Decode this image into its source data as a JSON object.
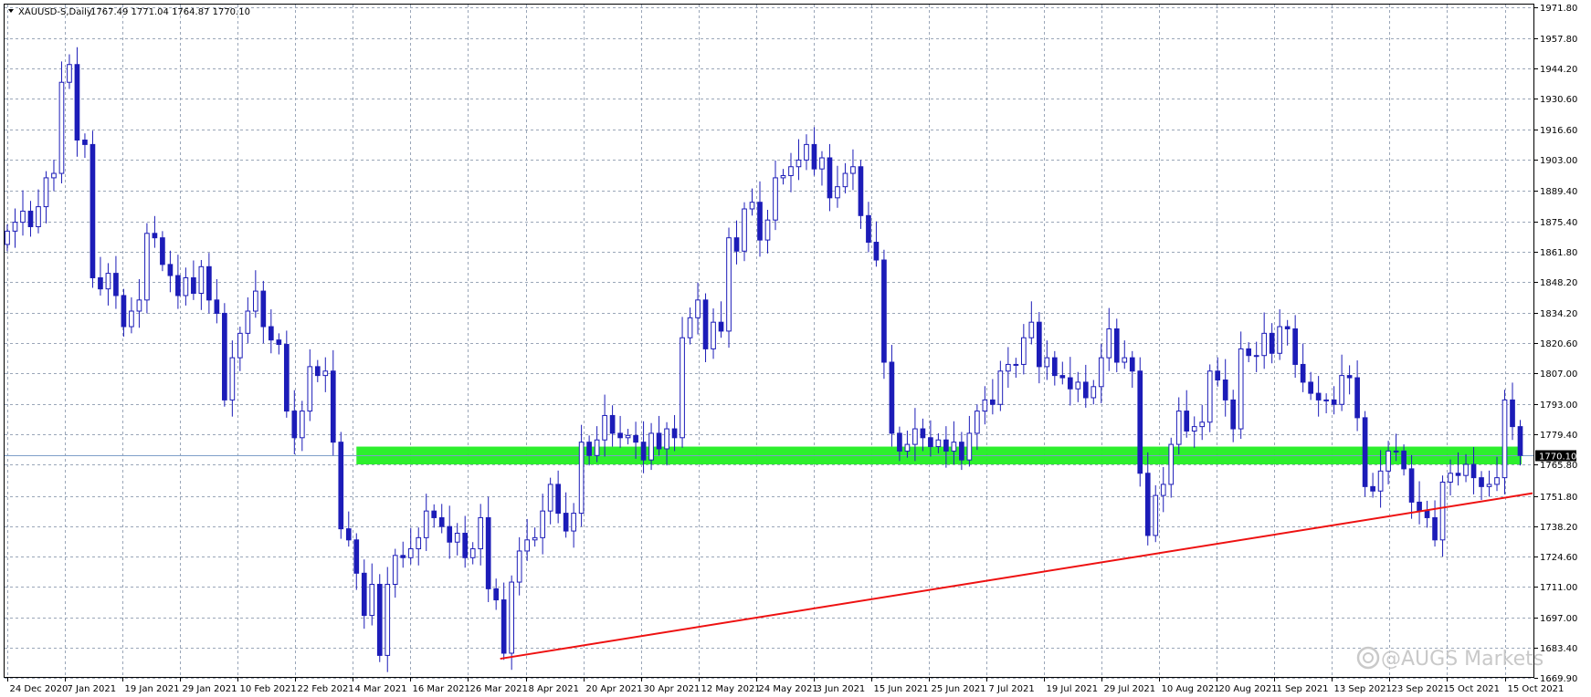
{
  "chart_data": {
    "type": "candlestick",
    "title": "XAUUSD-S,Daily  1767.49 1771.04 1764.87 1770.10",
    "symbol_period": "XAUUSD-S,Daily",
    "ohlc_header": "1767.49 1771.04 1764.87 1770.10",
    "ylim": [
      1669.9,
      1973.0
    ],
    "y_ticks": [
      "1971.80",
      "1957.80",
      "1944.20",
      "1930.60",
      "1916.60",
      "1903.00",
      "1889.40",
      "1875.40",
      "1861.80",
      "1848.20",
      "1834.20",
      "1820.60",
      "1807.00",
      "1793.00",
      "1779.40",
      "1765.80",
      "1751.80",
      "1738.20",
      "1724.60",
      "1711.00",
      "1697.00",
      "1683.40",
      "1669.90"
    ],
    "x_ticks": [
      "24 Dec 2020",
      "7 Jan 2021",
      "19 Jan 2021",
      "29 Jan 2021",
      "10 Feb 2021",
      "22 Feb 2021",
      "4 Mar 2021",
      "16 Mar 2021",
      "26 Mar 2021",
      "8 Apr 2021",
      "20 Apr 2021",
      "30 Apr 2021",
      "12 May 2021",
      "24 May 2021",
      "3 Jun 2021",
      "15 Jun 2021",
      "25 Jun 2021",
      "7 Jul 2021",
      "19 Jul 2021",
      "29 Jul 2021",
      "10 Aug 2021",
      "20 Aug 2021",
      "1 Sep 2021",
      "13 Sep 2021",
      "23 Sep 2021",
      "5 Oct 2021",
      "15 Oct 2021"
    ],
    "current_price": "1770.10",
    "support_zone": {
      "low": 1766.0,
      "high": 1774.0,
      "color": "#22ee22"
    },
    "trendline": {
      "from_date": "29 Mar 2021",
      "from_price": 1678.5,
      "to_date": "19 Oct 2021",
      "to_price": 1753.0,
      "color": "#ee1111"
    },
    "candle_color": "#1c1cb8",
    "grid": true,
    "watermark": "@AUGS Markets",
    "closes": [
      1871,
      1875,
      1880,
      1873,
      1882,
      1895,
      1897,
      1938,
      1946,
      1912,
      1910,
      1850,
      1845,
      1852,
      1842,
      1828,
      1835,
      1840,
      1870,
      1868,
      1856,
      1851,
      1842,
      1850,
      1843,
      1855,
      1840,
      1834,
      1795,
      1814,
      1825,
      1835,
      1844,
      1828,
      1822,
      1820,
      1790,
      1778,
      1790,
      1810,
      1806,
      1808,
      1776,
      1737,
      1732,
      1717,
      1698,
      1712,
      1680,
      1712,
      1725,
      1724,
      1728,
      1733,
      1745,
      1742,
      1738,
      1731,
      1735,
      1724,
      1728,
      1742,
      1710,
      1705,
      1681,
      1713,
      1727,
      1732,
      1733,
      1745,
      1757,
      1744,
      1736,
      1744,
      1776,
      1770,
      1777,
      1788,
      1780,
      1778,
      1779,
      1776,
      1768,
      1780,
      1773,
      1782,
      1778,
      1823,
      1832,
      1840,
      1818,
      1830,
      1826,
      1868,
      1862,
      1881,
      1884,
      1867,
      1876,
      1895,
      1896,
      1900,
      1903,
      1910,
      1899,
      1904,
      1886,
      1891,
      1897,
      1900,
      1878,
      1866,
      1858,
      1812,
      1780,
      1772,
      1775,
      1782,
      1778,
      1774,
      1777,
      1772,
      1776,
      1768,
      1780,
      1790,
      1795,
      1793,
      1808,
      1811,
      1811,
      1823,
      1830,
      1810,
      1814,
      1806,
      1805,
      1800,
      1803,
      1796,
      1801,
      1814,
      1827,
      1812,
      1814,
      1808,
      1762,
      1734,
      1752,
      1757,
      1775,
      1790,
      1781,
      1783,
      1785,
      1808,
      1804,
      1795,
      1782,
      1818,
      1815,
      1815,
      1825,
      1816,
      1828,
      1827,
      1811,
      1803,
      1798,
      1795,
      1795,
      1793,
      1806,
      1805,
      1787,
      1756,
      1754,
      1763,
      1772,
      1772,
      1764,
      1749,
      1745,
      1742,
      1732,
      1758,
      1762,
      1761,
      1766,
      1760,
      1756,
      1757,
      1760,
      1795,
      1783,
      1770
    ]
  }
}
